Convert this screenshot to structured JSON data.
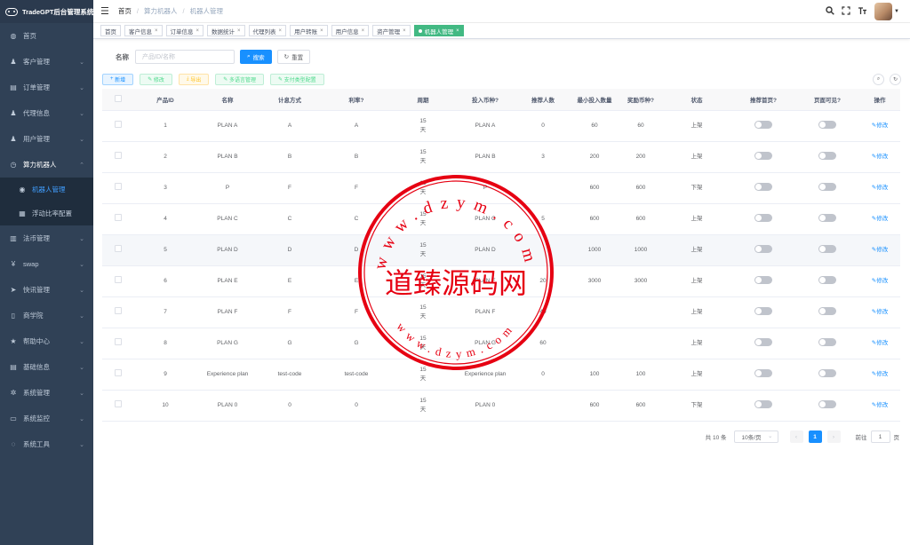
{
  "app": {
    "title": "TradeGPT后台管理系统"
  },
  "sidebar": {
    "items": [
      {
        "label": "首页",
        "icon": "dashboard-icon"
      },
      {
        "label": "客户管理",
        "icon": "user-icon"
      },
      {
        "label": "订单管理",
        "icon": "order-icon"
      },
      {
        "label": "代理信息",
        "icon": "agent-icon"
      },
      {
        "label": "用户管理",
        "icon": "user-icon"
      },
      {
        "label": "算力机器人",
        "icon": "robot-icon"
      },
      {
        "label": "机器人管理",
        "icon": "robot-manage-icon"
      },
      {
        "label": "浮动比率配置",
        "icon": "config-icon"
      },
      {
        "label": "法币管理",
        "icon": "currency-icon"
      },
      {
        "label": "swap",
        "icon": "yen-icon"
      },
      {
        "label": "快讯管理",
        "icon": "send-icon"
      },
      {
        "label": "商学院",
        "icon": "book-icon"
      },
      {
        "label": "帮助中心",
        "icon": "star-icon"
      },
      {
        "label": "基础信息",
        "icon": "doc-icon"
      },
      {
        "label": "系统管理",
        "icon": "gear-icon"
      },
      {
        "label": "系统监控",
        "icon": "monitor-icon"
      },
      {
        "label": "系统工具",
        "icon": "tool-icon"
      }
    ]
  },
  "breadcrumb": [
    "首页",
    "算力机器人",
    "机器人管理"
  ],
  "tags": [
    "首页",
    "客户信息",
    "订单信息",
    "数据统计",
    "代理列表",
    "用户转账",
    "用户信息",
    "资产管理",
    "机器人管理"
  ],
  "search": {
    "label": "名称",
    "placeholder": "产品ID/名称",
    "search_btn": "搜索",
    "reset_btn": "重置"
  },
  "toolbar": {
    "add": "新增",
    "edit": "修改",
    "export": "导出",
    "multi": "多语言管理",
    "pay": "支付类型配置"
  },
  "table": {
    "headers": [
      "产品ID",
      "名称",
      "计息方式",
      "利率?",
      "周期",
      "投入币种?",
      "推荐人数",
      "最小投入数量",
      "奖励币种?",
      "状态",
      "推荐首页?",
      "页面可见?",
      "操作"
    ],
    "edit_label": "修改",
    "rows": [
      {
        "id": "1",
        "name": "PLAN A",
        "interest": "A",
        "rate": "A",
        "period_num": "15",
        "period_unit": "天",
        "coin": "PLAN A",
        "refs": "0",
        "min": "60",
        "reward": "60",
        "status": "上架"
      },
      {
        "id": "2",
        "name": "PLAN B",
        "interest": "B",
        "rate": "B",
        "period_num": "15",
        "period_unit": "天",
        "coin": "PLAN B",
        "refs": "3",
        "min": "200",
        "reward": "200",
        "status": "上架"
      },
      {
        "id": "3",
        "name": "P",
        "interest": "F",
        "rate": "F",
        "period_num": "15",
        "period_unit": "天",
        "coin": "P",
        "refs": "",
        "min": "600",
        "reward": "600",
        "status": "下架"
      },
      {
        "id": "4",
        "name": "PLAN C",
        "interest": "C",
        "rate": "C",
        "period_num": "15",
        "period_unit": "天",
        "coin": "PLAN C",
        "refs": "5",
        "min": "600",
        "reward": "600",
        "status": "上架"
      },
      {
        "id": "5",
        "name": "PLAN D",
        "interest": "D",
        "rate": "D",
        "period_num": "15",
        "period_unit": "天",
        "coin": "PLAN D",
        "refs": "",
        "min": "1000",
        "reward": "1000",
        "status": "上架"
      },
      {
        "id": "6",
        "name": "PLAN E",
        "interest": "E",
        "rate": "E",
        "period_num": "15",
        "period_unit": "天",
        "coin": "PLAN E",
        "refs": "20",
        "min": "3000",
        "reward": "3000",
        "status": "上架"
      },
      {
        "id": "7",
        "name": "PLAN F",
        "interest": "F",
        "rate": "F",
        "period_num": "15",
        "period_unit": "天",
        "coin": "PLAN F",
        "refs": "40",
        "min": "",
        "reward": "",
        "status": "上架"
      },
      {
        "id": "8",
        "name": "PLAN G",
        "interest": "G",
        "rate": "G",
        "period_num": "15",
        "period_unit": "天",
        "coin": "PLAN G",
        "refs": "60",
        "min": "",
        "reward": "",
        "status": "上架"
      },
      {
        "id": "9",
        "name": "Experience plan",
        "interest": "test-code",
        "rate": "test-code",
        "period_num": "15",
        "period_unit": "天",
        "coin": "Experience plan",
        "refs": "0",
        "min": "100",
        "reward": "100",
        "status": "上架"
      },
      {
        "id": "10",
        "name": "PLAN 0",
        "interest": "0",
        "rate": "0",
        "period_num": "15",
        "period_unit": "天",
        "coin": "PLAN 0",
        "refs": "",
        "min": "600",
        "reward": "600",
        "status": "下架"
      }
    ]
  },
  "pagination": {
    "total": "共 10 条",
    "page_size": "10条/页",
    "current": "1",
    "goto_label": "前往",
    "goto_value": "1",
    "page_suffix": "页"
  },
  "watermark": {
    "text": "道臻源码网",
    "url_top": "www.dzym.com",
    "url_bottom": "www.dzym.com",
    "color": "#e60012"
  }
}
